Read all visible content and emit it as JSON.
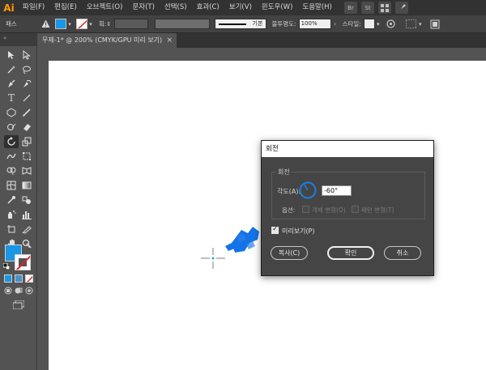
{
  "app": {
    "logo": "Ai"
  },
  "menu": {
    "items": [
      "파일(F)",
      "편집(E)",
      "오브젝트(O)",
      "문자(T)",
      "선택(S)",
      "효과(C)",
      "보기(V)",
      "윈도우(W)",
      "도움말(H)"
    ]
  },
  "menu_buttons": {
    "br": "Br",
    "st": "St"
  },
  "control": {
    "selection_label": "패스",
    "stroke_label": "획:",
    "stroke_style": "기본",
    "opacity_label": "불투명도:",
    "opacity_value": "100%",
    "style_label": "스타일:"
  },
  "document": {
    "tab_title": "무제-1* @ 200% (CMYK/GPU 미리 보기)",
    "close": "×"
  },
  "dialog": {
    "title": "회전",
    "group_title": "회전",
    "angle_label": "각도(A):",
    "angle_value": "-60°",
    "options_label": "옵션:",
    "transform_objects": "개체 변형(O)",
    "transform_patterns": "패턴 변형(T)",
    "preview": "미리보기(P)",
    "copy_button": "복사(C)",
    "ok_button": "확인",
    "cancel_button": "취소"
  },
  "colors": {
    "fill": "#1a96e6",
    "accent": "#1a80e0",
    "shape": "#1473e6"
  },
  "icons": [
    "selection-icon",
    "direct-selection-icon",
    "magic-wand-icon",
    "lasso-icon",
    "pen-icon",
    "curvature-icon",
    "type-icon",
    "line-icon",
    "rectangle-icon",
    "paintbrush-icon",
    "shaper-icon",
    "eraser-icon",
    "rotate-icon",
    "scale-icon",
    "warp-icon",
    "free-transform-icon",
    "shape-builder-icon",
    "perspective-icon",
    "mesh-icon",
    "gradient-icon",
    "eyedropper-icon",
    "blend-icon",
    "symbol-sprayer-icon",
    "column-graph-icon",
    "artboard-icon",
    "slice-icon",
    "hand-icon",
    "zoom-icon"
  ]
}
